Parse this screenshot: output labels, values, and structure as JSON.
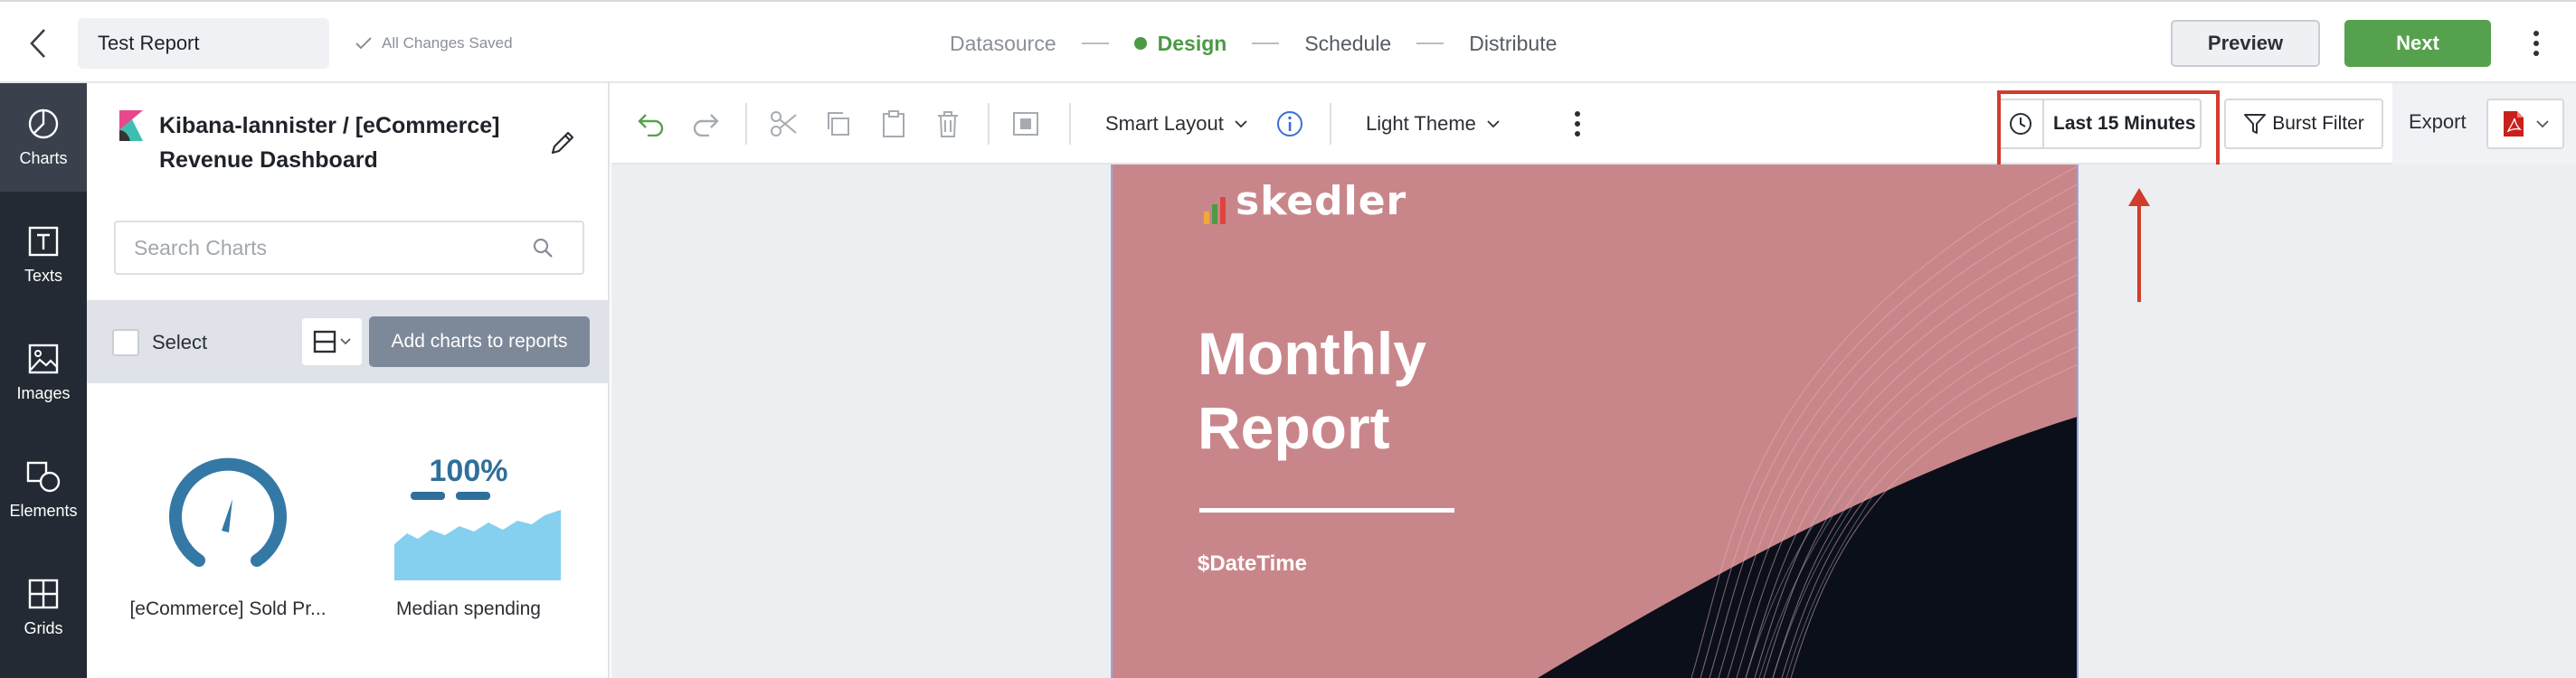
{
  "header": {
    "report_name": "Test Report",
    "save_status": "All Changes Saved",
    "steps": [
      {
        "label": "Datasource",
        "state": "done"
      },
      {
        "label": "Design",
        "state": "active"
      },
      {
        "label": "Schedule",
        "state": "pending"
      },
      {
        "label": "Distribute",
        "state": "pending"
      }
    ],
    "preview_label": "Preview",
    "next_label": "Next"
  },
  "rail": {
    "items": [
      {
        "label": "Charts",
        "icon": "pie-chart-icon",
        "active": true
      },
      {
        "label": "Texts",
        "icon": "text-box-icon",
        "active": false
      },
      {
        "label": "Images",
        "icon": "image-icon",
        "active": false
      },
      {
        "label": "Elements",
        "icon": "shapes-icon",
        "active": false
      },
      {
        "label": "Grids",
        "icon": "grid-icon",
        "active": false
      }
    ]
  },
  "panel": {
    "dashboard_title": "Kibana-lannister / [eCommerce] Revenue Dashboard",
    "search_placeholder": "Search Charts",
    "select_label": "Select",
    "add_button_label": "Add charts to reports",
    "charts": [
      {
        "label": "[eCommerce] Sold Pr...",
        "kind": "gauge"
      },
      {
        "label": "Median spending",
        "kind": "metric-area",
        "metric_text": "100%"
      }
    ]
  },
  "toolbar": {
    "layout_label": "Smart Layout",
    "theme_label": "Light Theme",
    "time_range": "Last 15 Minutes",
    "burst_filter_label": "Burst Filter",
    "export_label": "Export",
    "export_format_icon": "pdf-icon"
  },
  "page": {
    "logo_text": "skedler",
    "title_line1": "Monthly",
    "title_line2": "Report",
    "datetime_placeholder": "$DateTime"
  },
  "colors": {
    "accent_green": "#56a14d",
    "highlight_red": "#d33b2c",
    "page_background": "#c9868a",
    "rail_background": "#242a33"
  }
}
